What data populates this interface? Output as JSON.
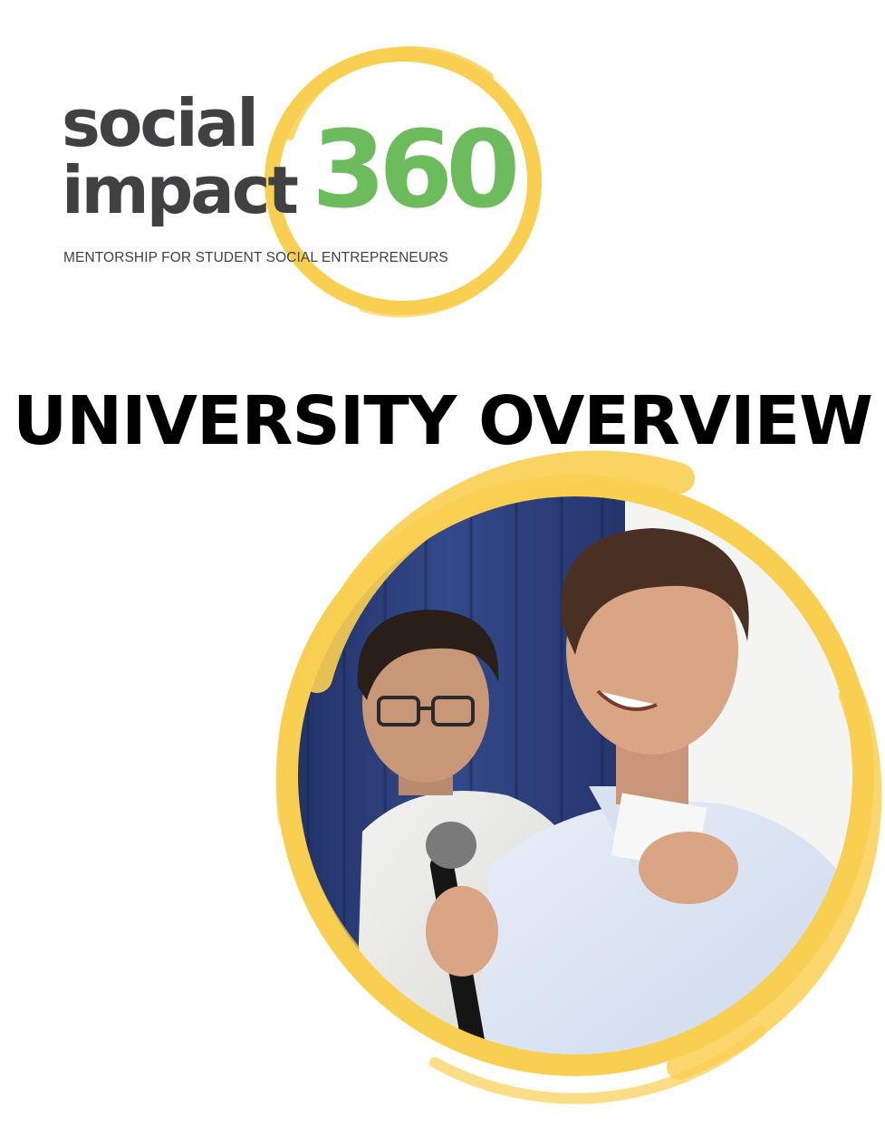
{
  "logo": {
    "word_1": "social",
    "word_2": "impact",
    "number": "360",
    "tagline": "MENTORSHIP FOR STUDENT SOCIAL ENTREPRENEURS"
  },
  "title": "UNIVERSITY OVERVIEW",
  "photo": {
    "icon": "brush-circle-photo",
    "subject": "two students presenting with microphone"
  },
  "colors": {
    "brand_yellow": "#f9cf52",
    "brand_green": "#6cbb5c",
    "logo_gray": "#414042",
    "title_black": "#000000",
    "curtain_blue": "#2c3f7a"
  }
}
